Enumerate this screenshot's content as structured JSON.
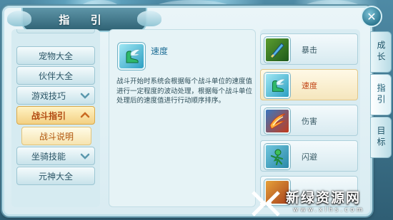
{
  "window": {
    "title": "指  引"
  },
  "menu": {
    "items": [
      {
        "label": "宠物大全",
        "chevron": false,
        "state": "normal"
      },
      {
        "label": "伙伴大全",
        "chevron": false,
        "state": "normal"
      },
      {
        "label": "游戏技巧",
        "chevron": "down",
        "state": "normal"
      },
      {
        "label": "战斗指引",
        "chevron": "up",
        "state": "active"
      },
      {
        "label": "战斗说明",
        "chevron": false,
        "state": "sub"
      },
      {
        "label": "坐骑技能",
        "chevron": "down",
        "state": "normal"
      },
      {
        "label": "元神大全",
        "chevron": false,
        "state": "normal"
      }
    ]
  },
  "detail": {
    "icon": "winged-boot-icon",
    "name": "速度",
    "description": "战斗开始时系统会根据每个战斗单位的速度值进行一定程度的波动处理，根据每个战斗单位处理后的速度值进行行动顺序排序。"
  },
  "attributes": [
    {
      "label": "暴击",
      "icon": "crit-blade-icon",
      "selected": false
    },
    {
      "label": "速度",
      "icon": "winged-boot-icon",
      "selected": true
    },
    {
      "label": "伤害",
      "icon": "flame-slash-icon",
      "selected": false
    },
    {
      "label": "闪避",
      "icon": "dodge-figure-icon",
      "selected": false
    },
    {
      "label": "",
      "icon": "partial-icon",
      "selected": false
    }
  ],
  "tabs": [
    {
      "label": "成长",
      "active": false
    },
    {
      "label": "指引",
      "active": true
    },
    {
      "label": "目标",
      "active": false
    }
  ],
  "close": {
    "glyph": "✕"
  },
  "watermark": {
    "title": "新绿资源网",
    "url": "www.xlhs.com"
  }
}
